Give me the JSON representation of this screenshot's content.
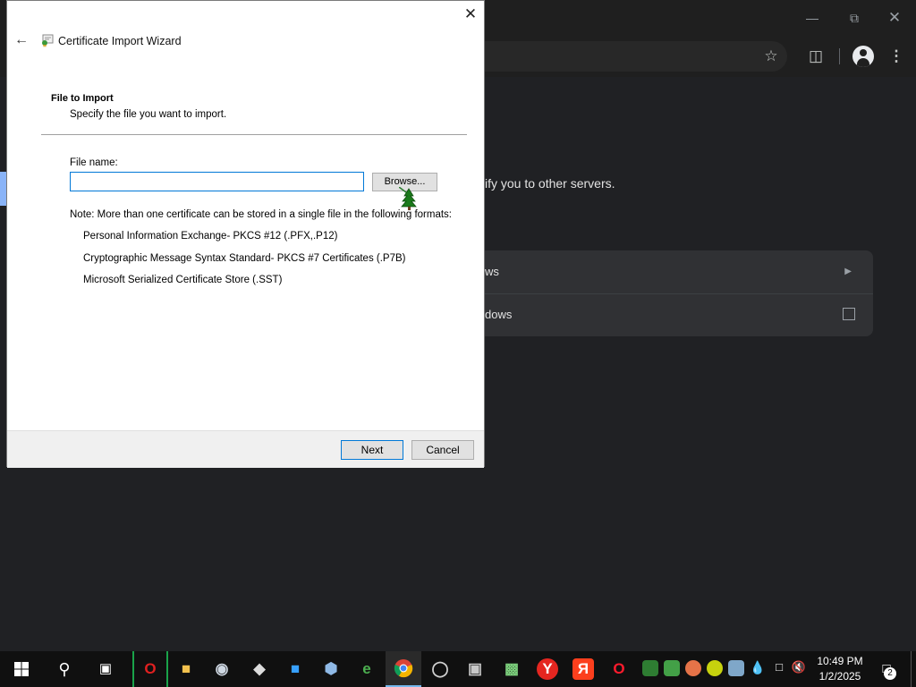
{
  "dialog": {
    "title": "Certificate Import Wizard",
    "section_title": "File to Import",
    "section_subtitle": "Specify the file you want to import.",
    "file_name_label": "File name:",
    "file_name_value": "",
    "browse_label": "Browse...",
    "note": "Note:  More than one certificate can be stored in a single file in the following formats:",
    "formats": [
      "Personal Information Exchange- PKCS #12 (.PFX,.P12)",
      "Cryptographic Message Syntax Standard- PKCS #7 Certificates (.P7B)",
      "Microsoft Serialized Certificate Store (.SST)"
    ],
    "next_label": "Next",
    "cancel_label": "Cancel",
    "close_icon": "close-icon",
    "back_icon": "back-arrow-icon"
  },
  "browser": {
    "page_text": "ify you to other servers.",
    "row1_label": "ws",
    "row2_label": "dows",
    "accent_color": "#8ab4f8"
  },
  "taskbar": {
    "time": "10:49 PM",
    "date": "1/2/2025",
    "notification_count": "2"
  }
}
